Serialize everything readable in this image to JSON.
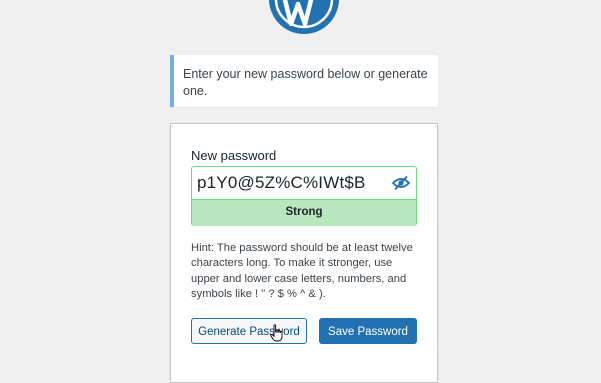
{
  "logo": {
    "icon": "wordpress-logo-icon",
    "color": "#2271b1"
  },
  "notice": {
    "text": "Enter your new password below or generate one."
  },
  "form": {
    "new_password_label": "New password",
    "password_value": "p1Y0@5Z%C%IWt$B",
    "visibility_icon": "eye-slash-icon",
    "strength": "Strong",
    "hint": "Hint: The password should be at least twelve characters long. To make it stronger, use upper and lower case letters, numbers, and symbols like ! \" ? $ % ^ & ).",
    "generate_label": "Generate Password",
    "save_label": "Save Password"
  },
  "colors": {
    "accent": "#2271b1",
    "notice_border": "#72aee6",
    "strong_bg": "#b8e6bf",
    "strong_border": "#68de7c"
  }
}
